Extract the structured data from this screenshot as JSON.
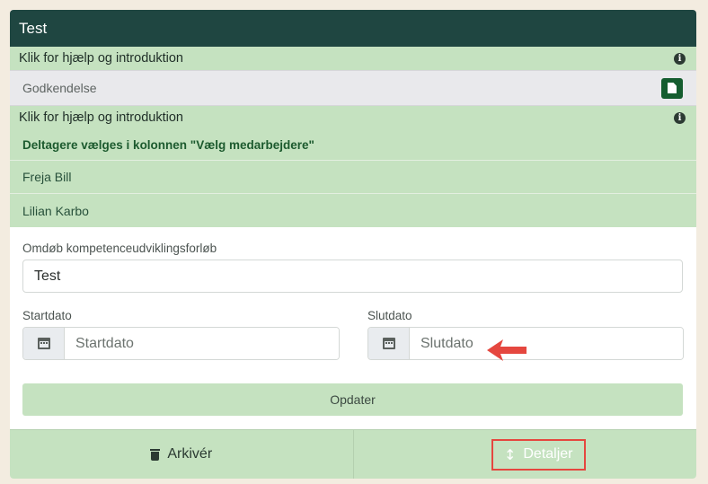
{
  "header": {
    "title": "Test"
  },
  "help_top": {
    "text": "Klik for hjælp og introduktion",
    "icon": "info-icon"
  },
  "approval": {
    "label": "Godkendelse",
    "icon": "document-icon"
  },
  "participants": {
    "help_text": "Klik for hjælp og introduktion",
    "note": "Deltagere vælges i kolonnen \"Vælg medarbejdere\"",
    "people": [
      "Freja Bill",
      "Lilian Karbo"
    ]
  },
  "form": {
    "rename_label": "Omdøb kompetenceudviklingsforløb",
    "rename_value": "Test",
    "start_label": "Startdato",
    "start_placeholder": "Startdato",
    "end_label": "Slutdato",
    "end_placeholder": "Slutdato",
    "update_label": "Opdater"
  },
  "footer": {
    "archive_label": "Arkivér",
    "details_label": "Detaljer"
  },
  "colors": {
    "header_bg": "#1f4641",
    "green_light": "#c5e2c0",
    "doc_button": "#155d2f",
    "highlight_red": "#e5473f"
  }
}
